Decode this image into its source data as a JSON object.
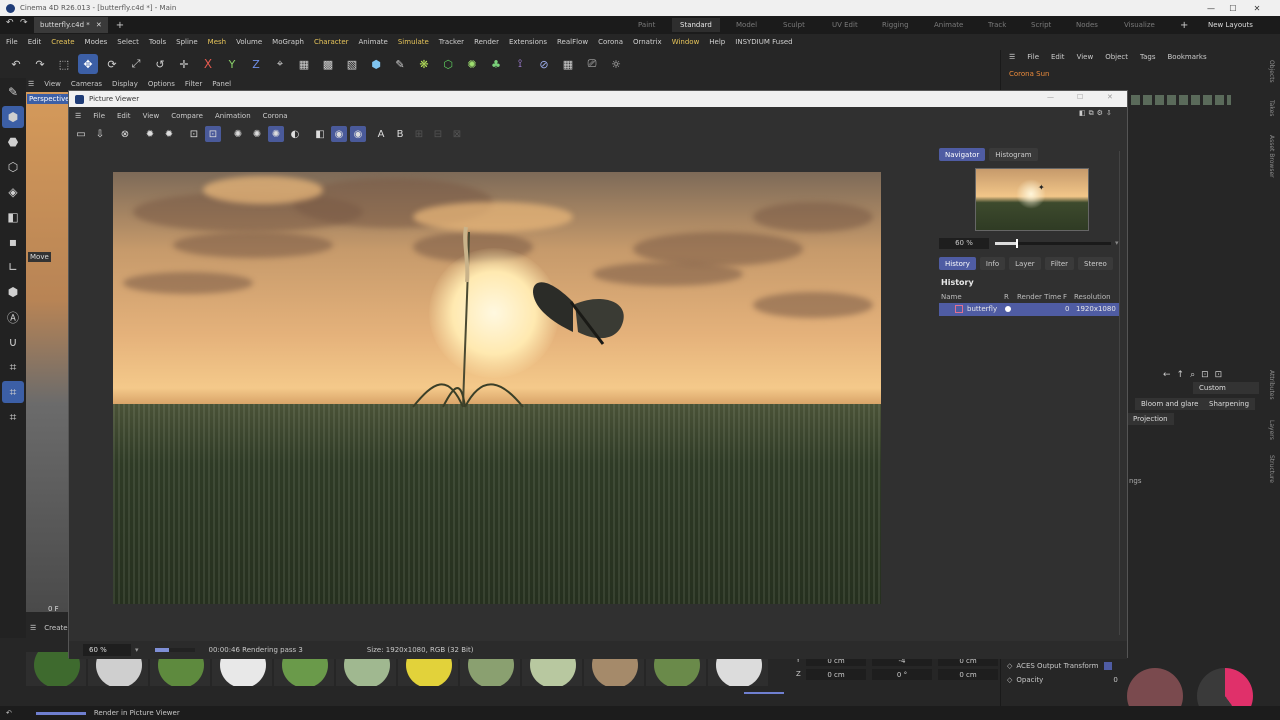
{
  "app": {
    "title": "Cinema 4D R26.013 - [butterfly.c4d *] - Main"
  },
  "tabs": {
    "document": "butterfly.c4d *",
    "add": "+"
  },
  "layouts": {
    "items": [
      "Paint",
      "Standard",
      "Model",
      "Sculpt",
      "UV Edit",
      "Rigging",
      "Animate",
      "Track",
      "Script",
      "Nodes",
      "Visualize"
    ],
    "add": "+",
    "new_layouts": "New Layouts"
  },
  "menubar": [
    "File",
    "Edit",
    "Create",
    "Modes",
    "Select",
    "Tools",
    "Spline",
    "Mesh",
    "Volume",
    "MoGraph",
    "Character",
    "Animate",
    "Simulate",
    "Tracker",
    "Render",
    "Extensions",
    "RealFlow",
    "Corona",
    "Ornatrix",
    "Window",
    "Help",
    "INSYDIUM Fused"
  ],
  "viewport": {
    "menu": [
      "View",
      "Cameras",
      "Display",
      "Options",
      "Filter",
      "Panel"
    ],
    "label": "Perspective",
    "move_label": "Move",
    "frame": "0 F"
  },
  "picture_viewer": {
    "title": "Picture Viewer",
    "menu": [
      "File",
      "Edit",
      "View",
      "Compare",
      "Animation",
      "Corona"
    ],
    "compare_a": "A",
    "compare_b": "B",
    "nav_tabs": [
      "Navigator",
      "Histogram"
    ],
    "zoom": "60 %",
    "zoom_fraction": 0.18,
    "hist_tabs": [
      "History",
      "Info",
      "Layer",
      "Filter",
      "Stereo"
    ],
    "history_label": "History",
    "history_columns": {
      "name": "Name",
      "r": "R",
      "render_time": "Render Time",
      "f": "F",
      "resolution": "Resolution"
    },
    "history_rows": [
      {
        "name": "butterfly",
        "f": "0",
        "resolution": "1920x1080"
      }
    ],
    "status": {
      "zoom": "60 %",
      "progress_fraction": 0.35,
      "render_text": "00:00:46 Rendering pass 3",
      "size_text": "Size: 1920x1080, RGB (32 Bit)"
    }
  },
  "objects_panel": {
    "menu": [
      "File",
      "Edit",
      "View",
      "Object",
      "Tags",
      "Bookmarks"
    ],
    "first_item": "Corona Sun"
  },
  "attributes": {
    "custom": "Custom",
    "bloom_tab": "Bloom and glare",
    "sharpening_tab": "Sharpening",
    "projection_tab": "Projection",
    "settings_fragment": "ngs",
    "aces_label": "ACES Output Transform",
    "opacity_label": "Opacity",
    "opacity_value": "0"
  },
  "side_labels": [
    "Objects",
    "Takes",
    "Asset Browser",
    "Attributes",
    "Layers",
    "Structure"
  ],
  "coordinates": [
    {
      "axis": "Y",
      "pos": "0 cm",
      "size": "-4",
      "rot": "0 cm"
    },
    {
      "axis": "Z",
      "pos": "0 cm",
      "size": "0 °",
      "rot": "0 cm"
    }
  ],
  "materials_panel": {
    "create": "Create"
  },
  "statusbar": {
    "text": "Render in Picture Viewer"
  },
  "colors": {
    "accent": "#4f5ca3",
    "highlight_menu": "#e6c45a",
    "orange": "#e98a3c"
  }
}
